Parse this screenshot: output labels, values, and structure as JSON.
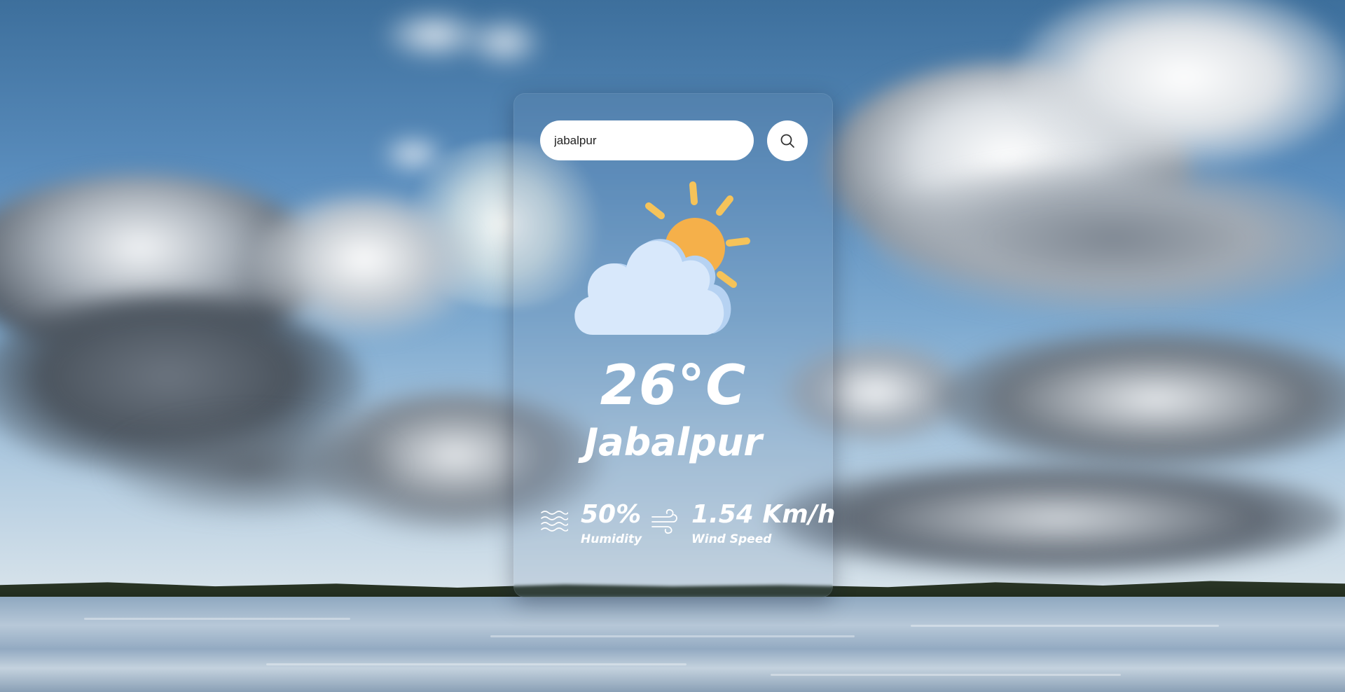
{
  "search": {
    "value": "jabalpur",
    "button_icon": "search-icon"
  },
  "weather": {
    "condition_icon": "partly-cloudy-icon",
    "temperature": "26°C",
    "city": "Jabalpur",
    "humidity": {
      "icon": "humidity-waves-icon",
      "value": "50%",
      "label": "Humidity"
    },
    "wind": {
      "icon": "wind-icon",
      "value": "1.54 Km/h",
      "label": "Wind Speed"
    }
  },
  "colors": {
    "card_text": "#ffffff",
    "sun": "#f5b04a",
    "cloud_front": "#d8e8fb",
    "cloud_back": "#b6d2f2"
  }
}
